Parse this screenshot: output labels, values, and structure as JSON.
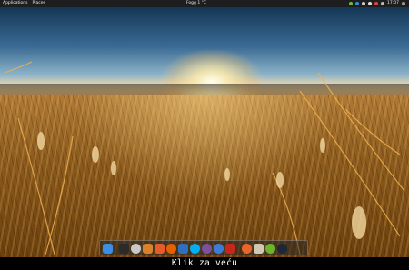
{
  "panel": {
    "applications": "Applications",
    "places": "Places",
    "center_text": "Fogg 1 °C",
    "clock": "17:07"
  },
  "dock": {
    "icons": [
      {
        "name": "finder-icon",
        "color": "#3a8ee6"
      },
      {
        "name": "terminal-icon",
        "color": "#2b2b2b"
      },
      {
        "name": "settings-icon",
        "color": "#c8c8c8"
      },
      {
        "name": "files-icon",
        "color": "#d9822b"
      },
      {
        "name": "store-icon",
        "color": "#e45c2a"
      },
      {
        "name": "firefox-icon",
        "color": "#e66000"
      },
      {
        "name": "mail-icon",
        "color": "#2f6fc2"
      },
      {
        "name": "skype-icon",
        "color": "#00aff0"
      },
      {
        "name": "viber-icon",
        "color": "#7b519d"
      },
      {
        "name": "web-icon",
        "color": "#3d7bd9"
      },
      {
        "name": "pdf-icon",
        "color": "#c8251d"
      },
      {
        "name": "media-icon",
        "color": "#e8662b"
      },
      {
        "name": "photos-icon",
        "color": "#d0c8b0"
      },
      {
        "name": "android-icon",
        "color": "#6bb52d"
      },
      {
        "name": "steam-icon",
        "color": "#1b2838"
      }
    ]
  },
  "caption": {
    "text": "Klik za veću"
  }
}
